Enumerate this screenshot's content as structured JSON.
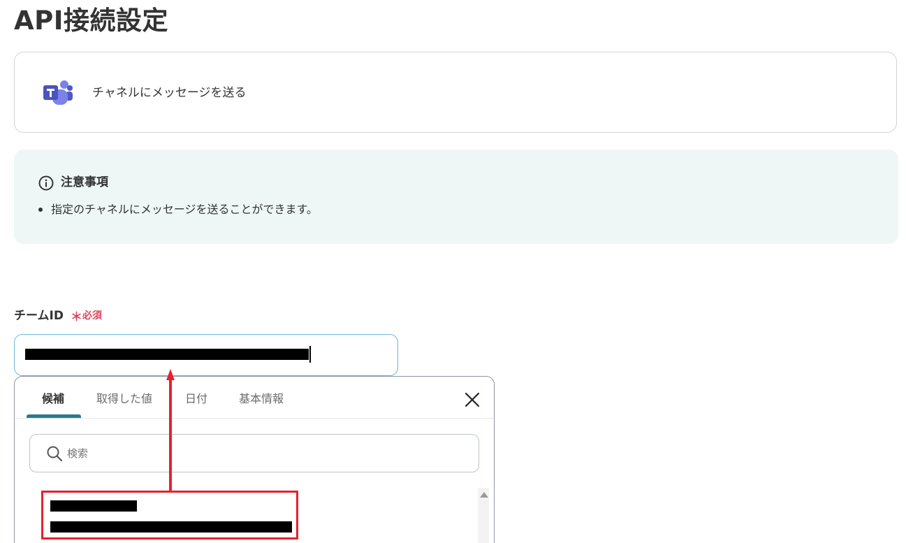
{
  "page": {
    "title": "API接続設定"
  },
  "action": {
    "icon": "microsoft-teams-icon",
    "label": "チャネルにメッセージを送る"
  },
  "notice": {
    "icon": "info-icon",
    "title": "注意事項",
    "items": [
      "指定のチャネルにメッセージを送ることができます。"
    ]
  },
  "team_id_field": {
    "label": "チームID",
    "required_mark": "＊",
    "required_text": "必須",
    "value": "[redacted]"
  },
  "picker": {
    "tabs": [
      {
        "label": "候補",
        "active": true
      },
      {
        "label": "取得した値",
        "active": false
      },
      {
        "label": "日付",
        "active": false
      },
      {
        "label": "基本情報",
        "active": false
      }
    ],
    "close_icon": "close-icon",
    "search": {
      "placeholder": "検索",
      "icon": "search-icon"
    },
    "candidates": [
      {
        "name": "[redacted]",
        "id": "[redacted]",
        "highlighted": true
      }
    ]
  },
  "colors": {
    "required": "#e0455d",
    "tab_underline": "#2a7a8c",
    "notice_background": "#eef7f6",
    "input_focus_border": "#6cb8d6",
    "annotation_red": "#e5222e"
  }
}
